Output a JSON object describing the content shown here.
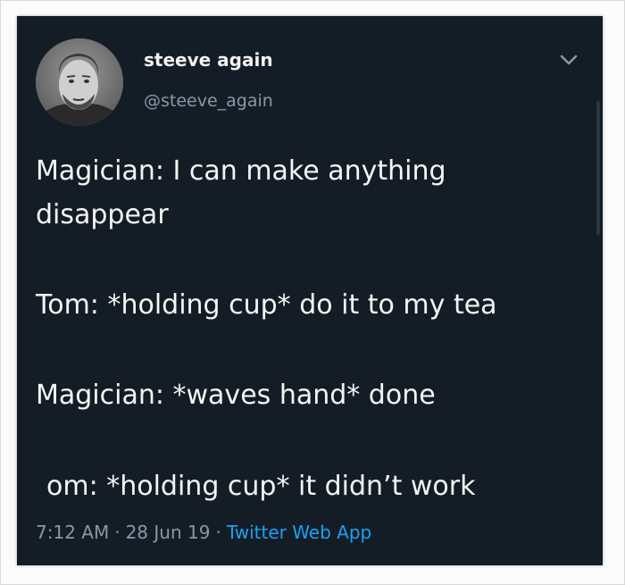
{
  "user": {
    "display_name": "steeve again",
    "handle": "@steeve_again"
  },
  "tweet": {
    "lines": [
      "Magician: I can make anything",
      "disappear",
      "Tom: *holding cup* do it to my tea",
      "Magician: *waves hand* done",
      "om: *holding cup* it didn’t work"
    ]
  },
  "meta": {
    "time": "7:12 AM",
    "date": "28 Jun 19",
    "separator": "·",
    "source": "Twitter Web App"
  },
  "icons": {
    "caret": "chevron-down-icon",
    "avatar": "avatar"
  },
  "colors": {
    "background": "#141d26",
    "secondary_text": "#8899a6",
    "link": "#1da1f2"
  }
}
